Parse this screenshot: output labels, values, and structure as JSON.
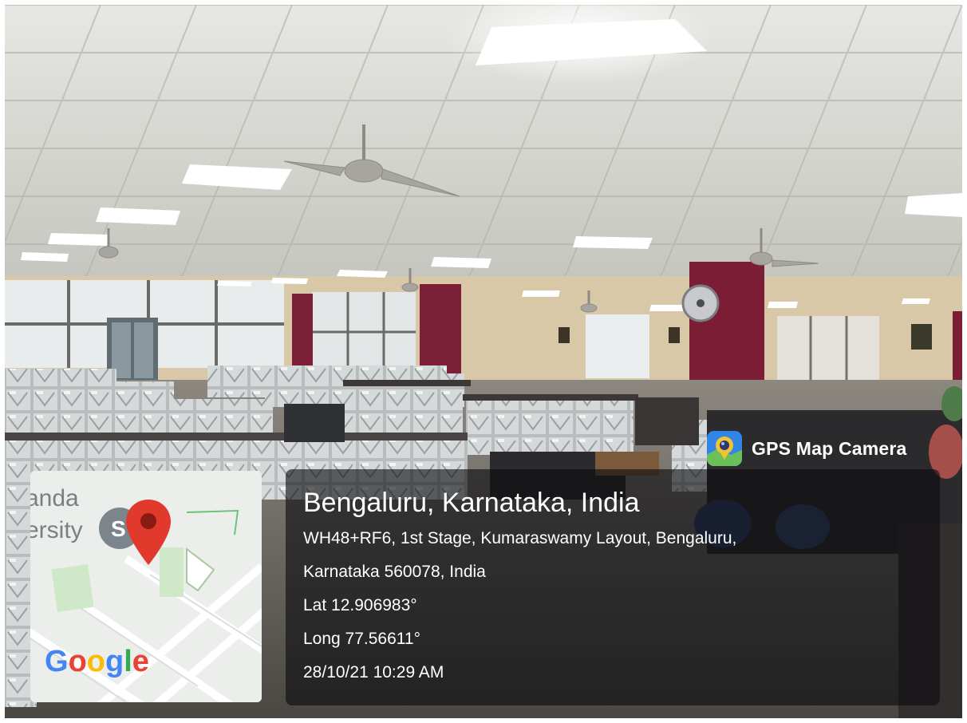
{
  "overlay": {
    "app_name": "GPS Map Camera",
    "app_icon": "gps-map-camera-app-icon",
    "location_title": "Bengaluru, Karnataka, India",
    "address_line_1": "WH48+RF6, 1st Stage, Kumaraswamy Layout, Bengaluru,",
    "address_line_2": "Karnataka 560078, India",
    "latitude": "Lat 12.906983°",
    "longitude": "Long 77.56611°",
    "datetime": "28/10/21 10:29 AM"
  },
  "map_thumbnail": {
    "label_line_1": "anda",
    "label_line_2": "ersity",
    "brand": "Google",
    "pin_color": "#e2392d",
    "brand_colors": [
      "#4285f4",
      "#ea4335",
      "#fbbc05",
      "#4285f4",
      "#34a853",
      "#ea4335"
    ]
  },
  "scene": {
    "description_tags": [
      "office-interior",
      "ceiling-lights",
      "ceiling-fans",
      "glass-block-cubicles",
      "maroon-pillars",
      "windows"
    ],
    "pillar_color": "#7a1f36",
    "ceiling_color": "#d9d9d6"
  }
}
